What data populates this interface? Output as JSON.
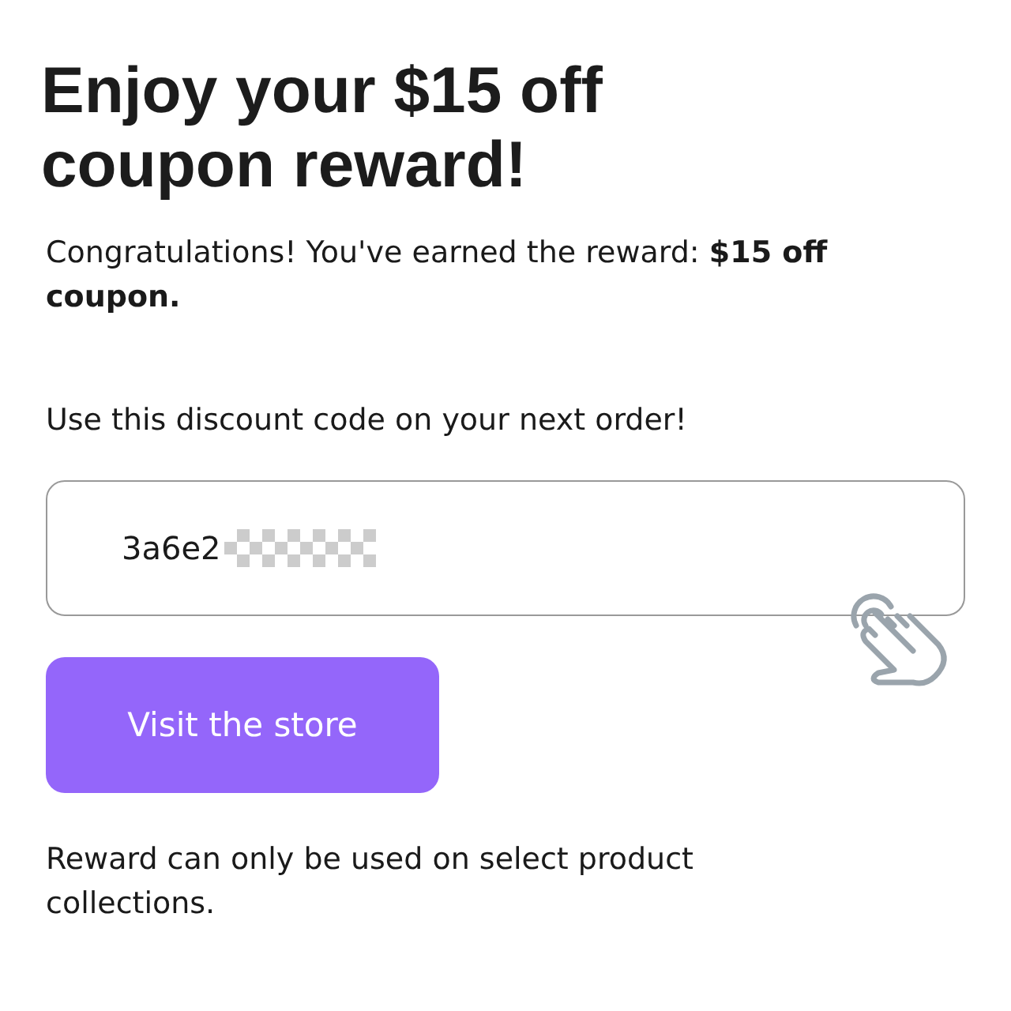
{
  "title": "Enjoy your $15 off coupon reward!",
  "message": "Congratulations! You've earned the reward: **$15 off coupon.**",
  "instruction": "Use this discount code on your next order!",
  "code_field": {
    "value": "3a6e2",
    "masked": true
  },
  "button": "Visit the store",
  "footnote": "Reward can only be used on select product collections."
}
